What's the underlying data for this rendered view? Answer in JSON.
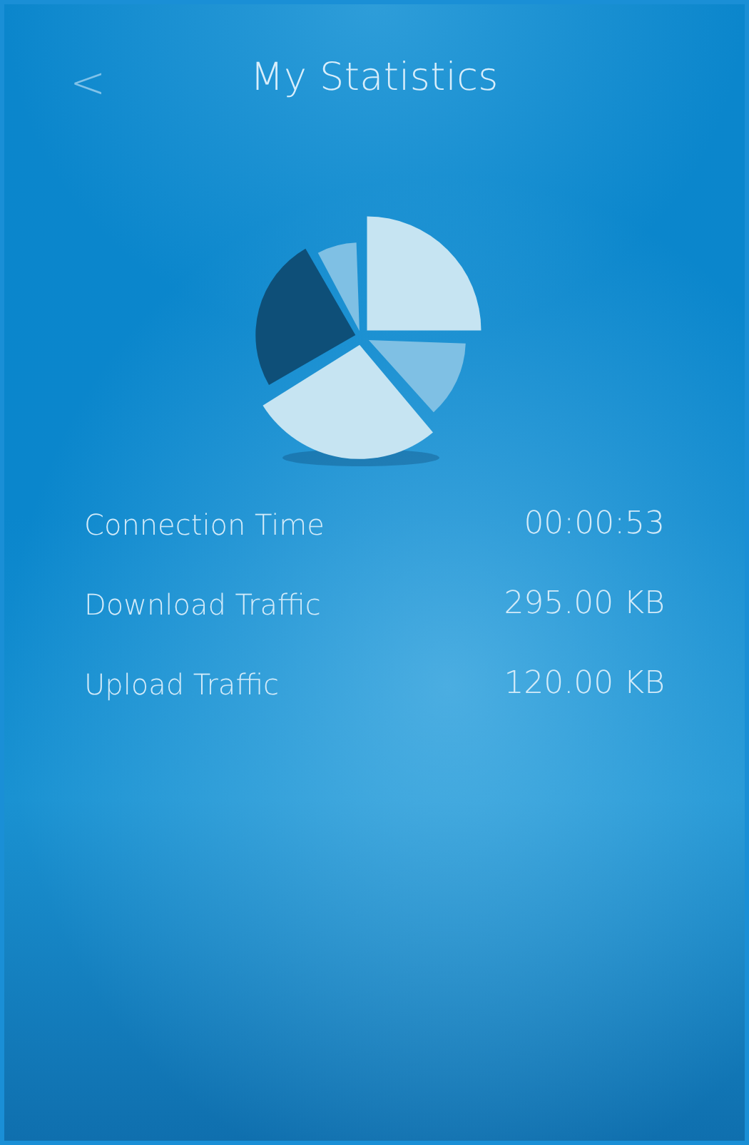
{
  "header": {
    "back": "<",
    "title": "My Statistics"
  },
  "stats": [
    {
      "label": "Connection Time",
      "value": "00:00:53"
    },
    {
      "label": "Download Traffic",
      "value": "295.00 KB"
    },
    {
      "label": "Upload Traffic",
      "value": "120.00 KB"
    }
  ]
}
